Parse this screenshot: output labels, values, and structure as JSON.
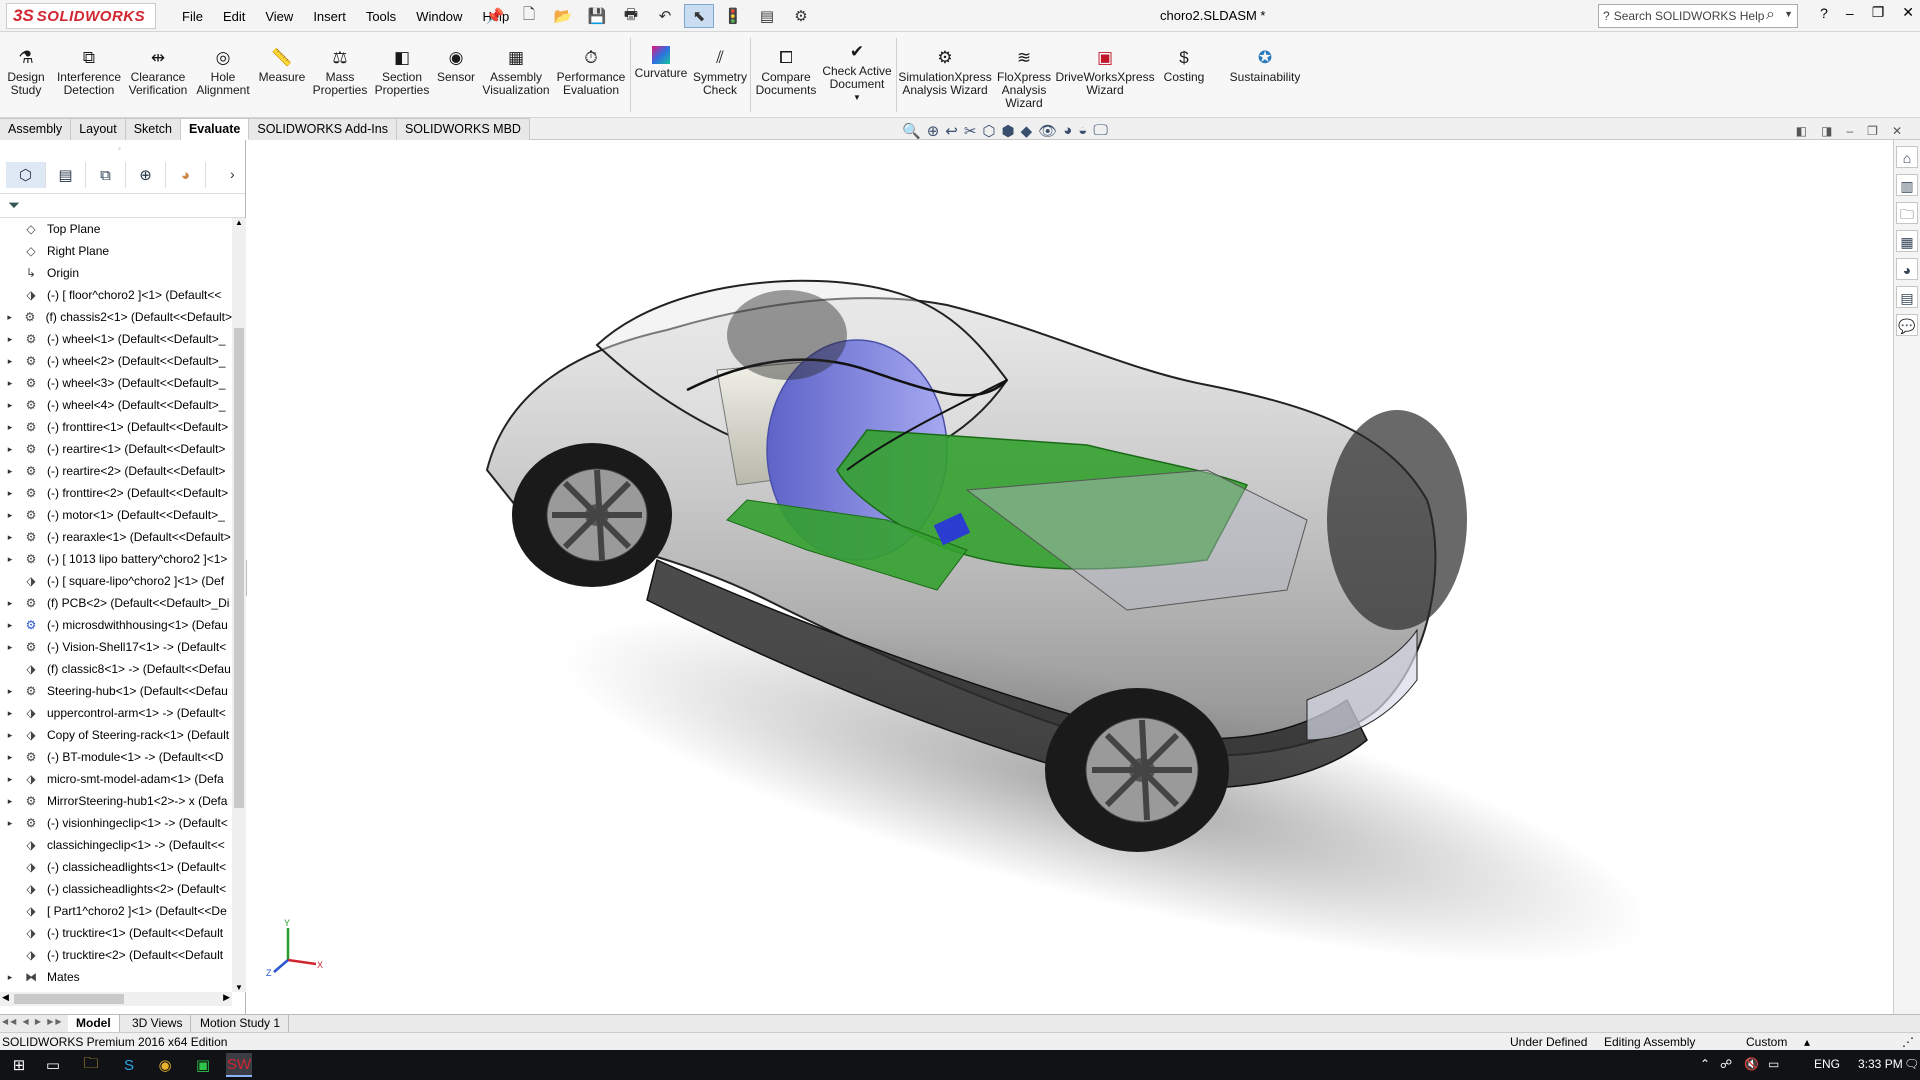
{
  "app": {
    "logo_prefix": "3S",
    "logo_text": "SOLIDWORKS",
    "document_title": "choro2.SLDASM *",
    "help_search_placeholder": "Search SOLIDWORKS Help"
  },
  "menus": [
    "File",
    "Edit",
    "View",
    "Insert",
    "Tools",
    "Window",
    "Help"
  ],
  "window_controls": [
    "?",
    "–",
    "❐",
    "✕"
  ],
  "command_manager": [
    {
      "label": "Design\nStudy",
      "icon": "design-study-icon"
    },
    {
      "label": "Interference\nDetection",
      "icon": "interference-detection-icon"
    },
    {
      "label": "Clearance\nVerification",
      "icon": "clearance-verification-icon"
    },
    {
      "label": "Hole\nAlignment",
      "icon": "hole-alignment-icon"
    },
    {
      "label": "Measure",
      "icon": "measure-icon"
    },
    {
      "label": "Mass\nProperties",
      "icon": "mass-properties-icon"
    },
    {
      "label": "Section\nProperties",
      "icon": "section-properties-icon"
    },
    {
      "label": "Sensor",
      "icon": "sensor-icon"
    },
    {
      "label": "Assembly\nVisualization",
      "icon": "assembly-visualization-icon"
    },
    {
      "label": "Performance\nEvaluation",
      "icon": "performance-evaluation-icon"
    },
    {
      "label": "Curvature",
      "icon": "curvature-icon"
    },
    {
      "label": "Symmetry\nCheck",
      "icon": "symmetry-check-icon"
    },
    {
      "label": "Compare\nDocuments",
      "icon": "compare-documents-icon"
    },
    {
      "label": "Check Active\nDocument",
      "icon": "check-active-document-icon"
    },
    {
      "label": "SimulationXpress\nAnalysis Wizard",
      "icon": "simulationxpress-icon"
    },
    {
      "label": "FloXpress\nAnalysis\nWizard",
      "icon": "floxpress-icon"
    },
    {
      "label": "DriveWorksXpress\nWizard",
      "icon": "driveworksxpress-icon"
    },
    {
      "label": "Costing",
      "icon": "costing-icon"
    },
    {
      "label": "Sustainability",
      "icon": "sustainability-icon"
    }
  ],
  "command_tabs": [
    {
      "label": "Assembly",
      "active": false
    },
    {
      "label": "Layout",
      "active": false
    },
    {
      "label": "Sketch",
      "active": false
    },
    {
      "label": "Evaluate",
      "active": true
    },
    {
      "label": "SOLIDWORKS Add-Ins",
      "active": false
    },
    {
      "label": "SOLIDWORKS MBD",
      "active": false
    }
  ],
  "feature_tree": [
    {
      "label": "Top Plane",
      "type": "plane",
      "expandable": false
    },
    {
      "label": "Right Plane",
      "type": "plane",
      "expandable": false
    },
    {
      "label": "Origin",
      "type": "origin",
      "expandable": false
    },
    {
      "label": "(-) [ floor^choro2 ]<1> (Default<<",
      "type": "part",
      "expandable": false
    },
    {
      "label": "(f) chassis2<1> (Default<<Default>",
      "type": "asm",
      "expandable": true
    },
    {
      "label": "(-) wheel<1> (Default<<Default>_",
      "type": "asm",
      "expandable": true
    },
    {
      "label": "(-) wheel<2> (Default<<Default>_",
      "type": "asm",
      "expandable": true
    },
    {
      "label": "(-) wheel<3> (Default<<Default>_",
      "type": "asm",
      "expandable": true
    },
    {
      "label": "(-) wheel<4> (Default<<Default>_",
      "type": "asm",
      "expandable": true
    },
    {
      "label": "(-) fronttire<1> (Default<<Default>",
      "type": "asm",
      "expandable": true
    },
    {
      "label": "(-) reartire<1> (Default<<Default>",
      "type": "asm",
      "expandable": true
    },
    {
      "label": "(-) reartire<2> (Default<<Default>",
      "type": "asm",
      "expandable": true
    },
    {
      "label": "(-) fronttire<2> (Default<<Default>",
      "type": "asm",
      "expandable": true
    },
    {
      "label": "(-) motor<1> (Default<<Default>_",
      "type": "asm",
      "expandable": true
    },
    {
      "label": "(-) rearaxle<1> (Default<<Default>",
      "type": "asm",
      "expandable": true
    },
    {
      "label": "(-) [ 1013 lipo battery^choro2 ]<1>",
      "type": "asm",
      "expandable": true
    },
    {
      "label": "(-) [ square-lipo^choro2 ]<1> (Def",
      "type": "part",
      "expandable": false
    },
    {
      "label": "(f) PCB<2> (Default<<Default>_Di",
      "type": "asm",
      "expandable": true
    },
    {
      "label": "(-) microsdwithhousing<1> (Defau",
      "type": "asm-blue",
      "expandable": true
    },
    {
      "label": "(-) Vision-Shell17<1> -> (Default<",
      "type": "asm",
      "expandable": true
    },
    {
      "label": "(f) classic8<1> -> (Default<<Defau",
      "type": "part",
      "expandable": false
    },
    {
      "label": "Steering-hub<1> (Default<<Defau",
      "type": "asm",
      "expandable": true
    },
    {
      "label": "uppercontrol-arm<1> -> (Default<",
      "type": "part",
      "expandable": true
    },
    {
      "label": "Copy of Steering-rack<1> (Default",
      "type": "part",
      "expandable": true
    },
    {
      "label": "(-) BT-module<1> -> (Default<<D",
      "type": "asm",
      "expandable": true
    },
    {
      "label": "micro-smt-model-adam<1> (Defa",
      "type": "part",
      "expandable": true
    },
    {
      "label": "MirrorSteering-hub1<2>-> x (Defa",
      "type": "asm",
      "expandable": true
    },
    {
      "label": "(-) visionhingeclip<1> -> (Default<",
      "type": "asm",
      "expandable": true
    },
    {
      "label": "classichingeclip<1> -> (Default<<",
      "type": "part",
      "expandable": false
    },
    {
      "label": "(-) classicheadlights<1> (Default<",
      "type": "part",
      "expandable": false
    },
    {
      "label": "(-) classicheadlights<2> (Default<",
      "type": "part",
      "expandable": false
    },
    {
      "label": "[ Part1^choro2 ]<1> (Default<<De",
      "type": "part",
      "expandable": false
    },
    {
      "label": "(-) trucktire<1> (Default<<Default",
      "type": "part",
      "expandable": false
    },
    {
      "label": "(-) trucktire<2> (Default<<Default",
      "type": "part",
      "expandable": false
    },
    {
      "label": "Mates",
      "type": "mates",
      "expandable": true
    }
  ],
  "bottom_tabs": [
    {
      "label": "Model",
      "active": true
    },
    {
      "label": "3D Views",
      "active": false
    },
    {
      "label": "Motion Study 1",
      "active": false
    }
  ],
  "status": {
    "edition": "SOLIDWORKS Premium 2016 x64 Edition",
    "definition": "Under Defined",
    "mode": "Editing Assembly",
    "units": "Custom",
    "units_arrow": "▴"
  },
  "triad": {
    "x": "X",
    "y": "Y",
    "z": "Z"
  },
  "taskbar": {
    "language": "ENG",
    "time": "3:33 PM"
  },
  "colors": {
    "brand": "#d22630",
    "battery": "#7b7fe0",
    "pcb": "#2fa82a",
    "body": "#5a5a5a"
  }
}
